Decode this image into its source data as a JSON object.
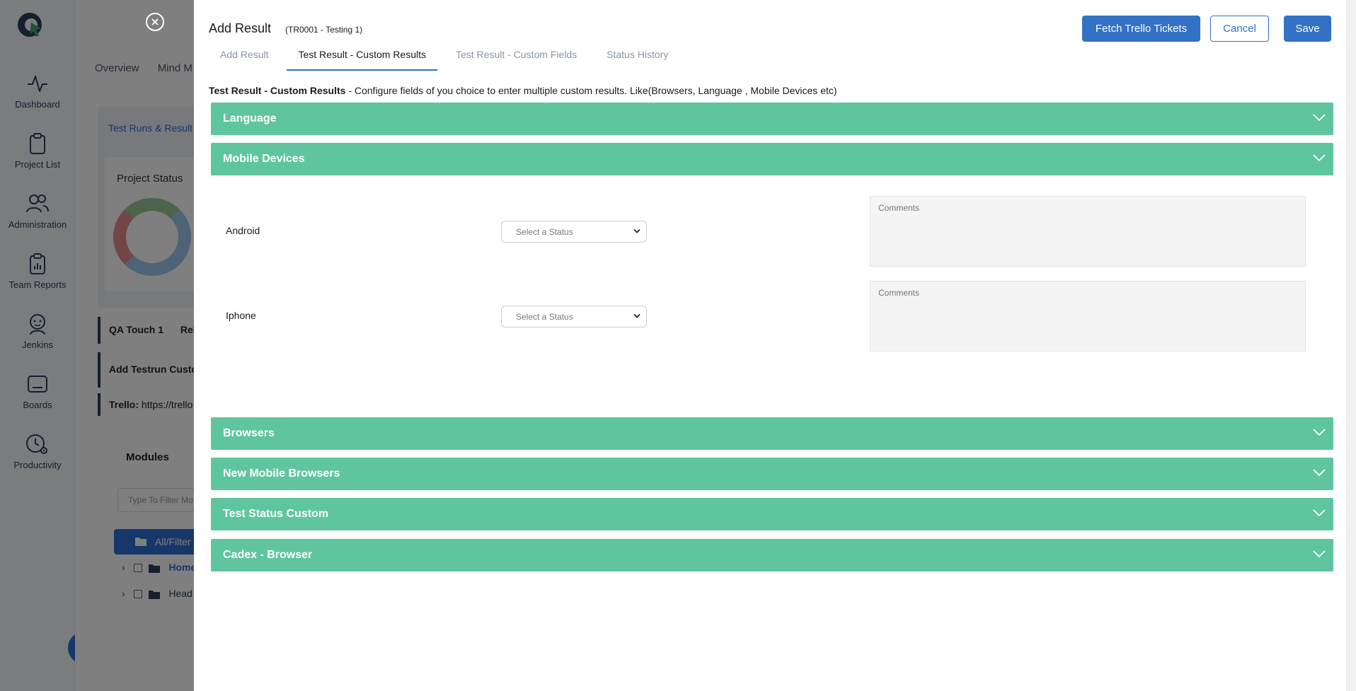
{
  "sidebar": {
    "items": [
      {
        "label": "Dashboard",
        "icon": "activity-icon"
      },
      {
        "label": "Project List",
        "icon": "clipboard-icon"
      },
      {
        "label": "Administration",
        "icon": "users-icon"
      },
      {
        "label": "Team Reports",
        "icon": "report-clipboard-icon"
      },
      {
        "label": "Jenkins",
        "icon": "jenkins-icon"
      },
      {
        "label": "Boards",
        "icon": "board-icon"
      },
      {
        "label": "Productivity",
        "icon": "clock-gear-icon"
      }
    ]
  },
  "background": {
    "tabs": [
      "Overview",
      "Mind M"
    ],
    "breadcrumb": "Test Runs & Result",
    "project_status": "Project Status",
    "row1_a": "QA Touch 1",
    "row1_b": "Rel",
    "row2": "Add Testrun Custo",
    "trello_label": "Trello:",
    "trello_url": "https://trello",
    "modules": "Modules",
    "filter_placeholder": "Type To Filter Mo",
    "all_filter": "All/Filter",
    "tree": [
      "Home",
      "Head"
    ]
  },
  "modal": {
    "title": "Add Result",
    "subtitle": "(TR0001 - Testing 1)",
    "buttons": {
      "fetch_trello": "Fetch Trello Tickets",
      "cancel": "Cancel",
      "save": "Save"
    },
    "tabs": [
      {
        "label": "Add Result",
        "active": false
      },
      {
        "label": "Test Result - Custom Results",
        "active": true
      },
      {
        "label": "Test Result - Custom Fields",
        "active": false
      },
      {
        "label": "Status History",
        "active": false
      }
    ],
    "description": {
      "bold": "Test Result - Custom Results",
      "text": " - Configure fields of you choice to enter multiple custom results. Like(Browsers, Language , Mobile Devices etc)"
    },
    "sections": [
      {
        "label": "Language",
        "expanded": false
      },
      {
        "label": "Mobile Devices",
        "expanded": true
      },
      {
        "label": "Browsers",
        "expanded": false
      },
      {
        "label": "New Mobile Browsers",
        "expanded": false
      },
      {
        "label": "Test Status Custom",
        "expanded": false
      },
      {
        "label": "Cadex - Browser",
        "expanded": false
      }
    ],
    "mobile_devices": [
      {
        "name": "Android",
        "status_placeholder": "Select a Status",
        "comments_placeholder": "Comments"
      },
      {
        "name": "Iphone",
        "status_placeholder": "Select a Status",
        "comments_placeholder": "Comments"
      }
    ]
  },
  "colors": {
    "accordion": "#5fc59e",
    "primary": "#3271c5",
    "overlay": "rgba(0,0,0,0.5)"
  }
}
